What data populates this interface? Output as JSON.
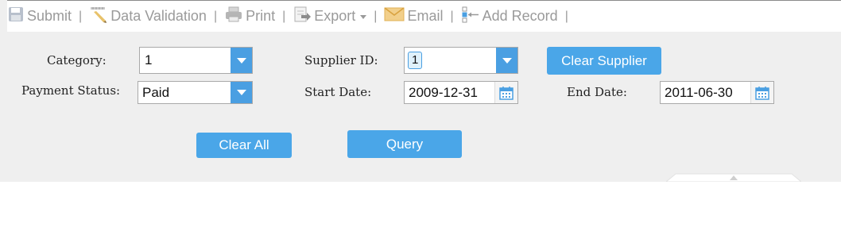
{
  "toolbar": {
    "submit": "Submit",
    "data_validation": "Data Validation",
    "print": "Print",
    "export": "Export",
    "email": "Email",
    "add_record": "Add Record",
    "separator": "|"
  },
  "form": {
    "category": {
      "label": "Category:",
      "value": "1"
    },
    "supplier_id": {
      "label": "Supplier ID:",
      "value": "1"
    },
    "payment_status": {
      "label": "Payment Status:",
      "value": "Paid"
    },
    "start_date": {
      "label": "Start Date:",
      "value": "2009-12-31"
    },
    "end_date": {
      "label": "End Date:",
      "value": "2011-06-30"
    }
  },
  "buttons": {
    "clear_supplier": "Clear Supplier",
    "clear_all": "Clear All",
    "query": "Query"
  },
  "colors": {
    "accent": "#4aa6e8",
    "toolbar_text": "#9a9a9a",
    "panel_bg": "#efefef"
  }
}
